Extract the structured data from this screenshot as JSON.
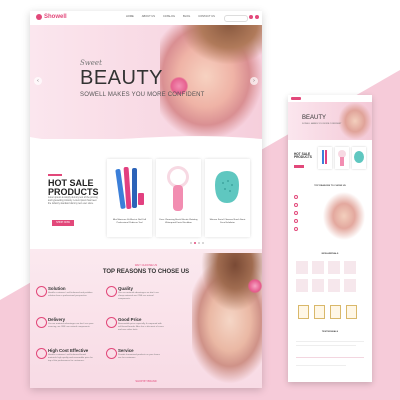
{
  "brand": {
    "name": "Showell",
    "accent": "#e2487a",
    "background": "#f3c7d6"
  },
  "nav": {
    "items": [
      "HOME",
      "ABOUT US",
      "CATALOG",
      "BLOG",
      "CONTACT US"
    ]
  },
  "hero": {
    "script": "Sweet",
    "title": "BEAUTY",
    "subtitle": "SOWELL MAKES YOU MORE CONFIDENT",
    "prev_icon": "‹",
    "next_icon": "›"
  },
  "hot_sale": {
    "title_line1": "HOT SALE",
    "title_line2": "PRODUCTS",
    "description": "Lorem ipsum is simply dummy text of the printing and typesetting industry. Lorem ipsum has been the industry standard dummy text ever since.",
    "button": "SHOP NOW",
    "products": [
      {
        "name": "Mini Manicure Kit Electric Nail Drill Professional Pedicure Tool",
        "color": "#3b7fd9"
      },
      {
        "name": "Face Cleansing Brush Electric Rotating Waterproof Facial Scrubber",
        "color": "#f3a6bf"
      },
      {
        "name": "Silicone Facial Cleanser Brush Sonic Face Exfoliator",
        "color": "#5fc7c0"
      }
    ]
  },
  "reasons": {
    "kicker": "WHY CHOOSE US",
    "title": "TOP REASONS TO CHOSE US",
    "features": [
      {
        "title": "Solution",
        "text": "Handle customers' well-informed and problem solution from a professional perspective."
      },
      {
        "title": "Quality",
        "text": "Use our material advantages we don't use cheap materials we ONE use natural components."
      },
      {
        "title": "Delivery",
        "text": "Our our material advantages we don't use poor sourcing, we ONE use natural components."
      },
      {
        "title": "Good Price",
        "text": "Reasonable price especially if compared with self-brand brands. Also has a discount of cases and over other feels."
      },
      {
        "title": "High Cost Effective",
        "text": "Handle customers' well-informed brand materials high quality and reasonable price for top of the performance for customers."
      },
      {
        "title": "Service",
        "text": "Provide humanized products as your lovers see for customers."
      }
    ]
  },
  "footer_kicker": "SHOP BY BRAND",
  "mobile": {
    "hero_title": "BEAUTY",
    "hero_sub": "SOWELL MAKES YOU MORE CONFIDENT",
    "hot": "HOT SALE PRODUCTS",
    "reasons": "TOP REASONS TO CHOSE US",
    "sections": [
      "NEW ARRIVALS",
      "TESTIMONIALS"
    ]
  }
}
